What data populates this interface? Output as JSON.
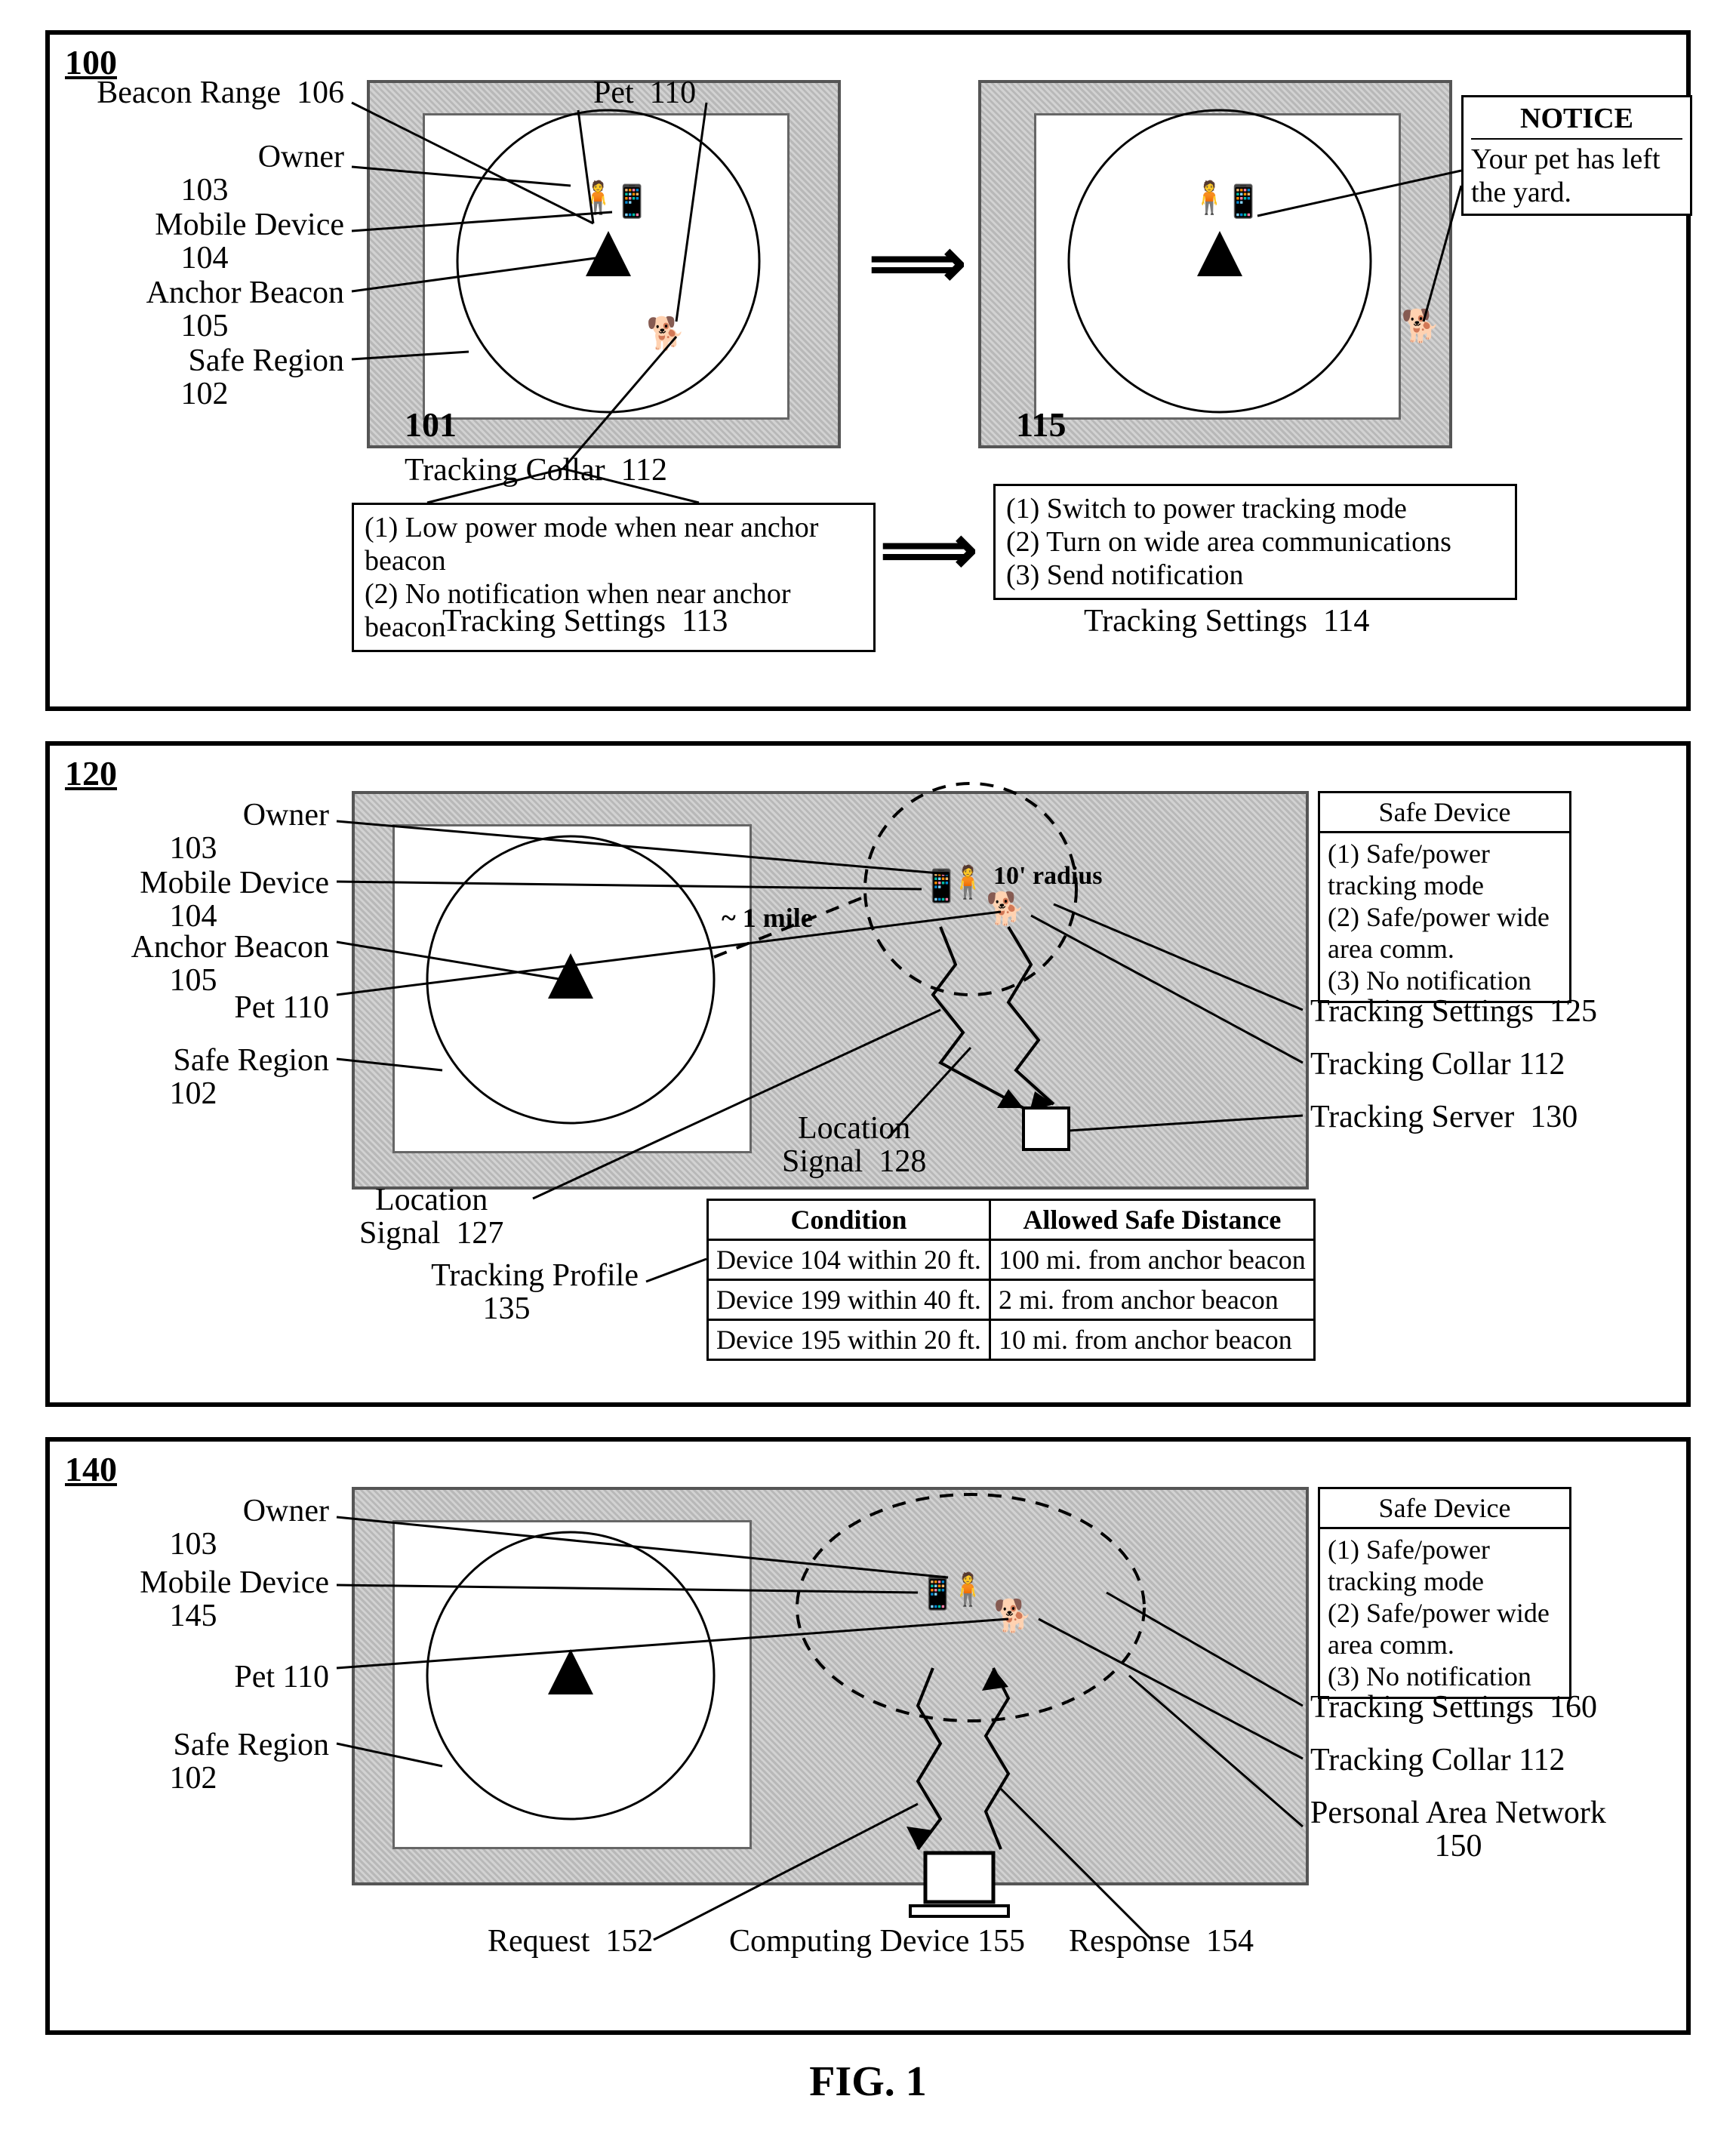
{
  "fig_caption": "FIG. 1",
  "panel100": {
    "num": "100",
    "labels": {
      "beacon_range": "Beacon Range",
      "beacon_range_num": "106",
      "pet": "Pet",
      "pet_num": "110",
      "owner": "Owner",
      "owner_num": "103",
      "mobile": "Mobile Device",
      "mobile_num": "104",
      "anchor": "Anchor Beacon",
      "anchor_num": "105",
      "safe": "Safe Region",
      "safe_num": "102",
      "collar": "Tracking Collar",
      "collar_num": "112",
      "settingsA": "Tracking Settings",
      "settingsA_num": "113",
      "settingsB": "Tracking Settings",
      "settingsB_num": "114",
      "scene_a": "101",
      "scene_b": "115",
      "notice_title": "NOTICE",
      "notice_body": "Your pet has left the yard."
    },
    "settingsA_items": [
      "(1) Low power mode when near anchor beacon",
      "(2) No notification when near anchor beacon"
    ],
    "settingsB_items": [
      "(1) Switch to power tracking mode",
      "(2) Turn on wide area communications",
      "(3) Send notification"
    ]
  },
  "panel120": {
    "num": "120",
    "labels": {
      "owner": "Owner",
      "owner_num": "103",
      "mobile": "Mobile Device",
      "mobile_num": "104",
      "anchor": "Anchor Beacon",
      "anchor_num": "105",
      "pet": "Pet",
      "pet_num": "110",
      "safe": "Safe Region",
      "safe_num": "102",
      "loc1": "Location",
      "loc1b": "Signal",
      "loc1_num": "127",
      "loc2": "Location",
      "loc2b": "Signal",
      "loc2_num": "128",
      "settings": "Tracking Settings",
      "settings_num": "125",
      "collar": "Tracking Collar",
      "collar_num": "112",
      "server": "Tracking Server",
      "server_num": "130",
      "profile": "Tracking Profile",
      "profile_num": "135",
      "safedev": "Safe Device",
      "dist1": "~ 1 mile",
      "dist2": "10' radius"
    },
    "safe_device_items": [
      "(1) Safe/power tracking mode",
      "(2) Safe/power wide area comm.",
      "(3) No notification"
    ],
    "profile_head": [
      "Condition",
      "Allowed Safe Distance"
    ],
    "profile_rows": [
      [
        "Device 104 within 20 ft.",
        "100 mi. from anchor beacon"
      ],
      [
        "Device 199 within 40 ft.",
        "2 mi. from anchor beacon"
      ],
      [
        "Device 195 within 20 ft.",
        "10 mi. from anchor beacon"
      ]
    ]
  },
  "panel140": {
    "num": "140",
    "labels": {
      "owner": "Owner",
      "owner_num": "103",
      "mobile": "Mobile Device",
      "mobile_num": "145",
      "pet": "Pet",
      "pet_num": "110",
      "safe": "Safe Region",
      "safe_num": "102",
      "request": "Request",
      "request_num": "152",
      "device": "Computing Device",
      "device_num": "155",
      "response": "Response",
      "response_num": "154",
      "settings": "Tracking Settings",
      "settings_num": "160",
      "collar": "Tracking Collar",
      "collar_num": "112",
      "pan": "Personal Area Network",
      "pan_num": "150",
      "safedev": "Safe Device"
    },
    "safe_device_items": [
      "(1) Safe/power tracking mode",
      "(2) Safe/power wide area comm.",
      "(3) No notification"
    ]
  }
}
